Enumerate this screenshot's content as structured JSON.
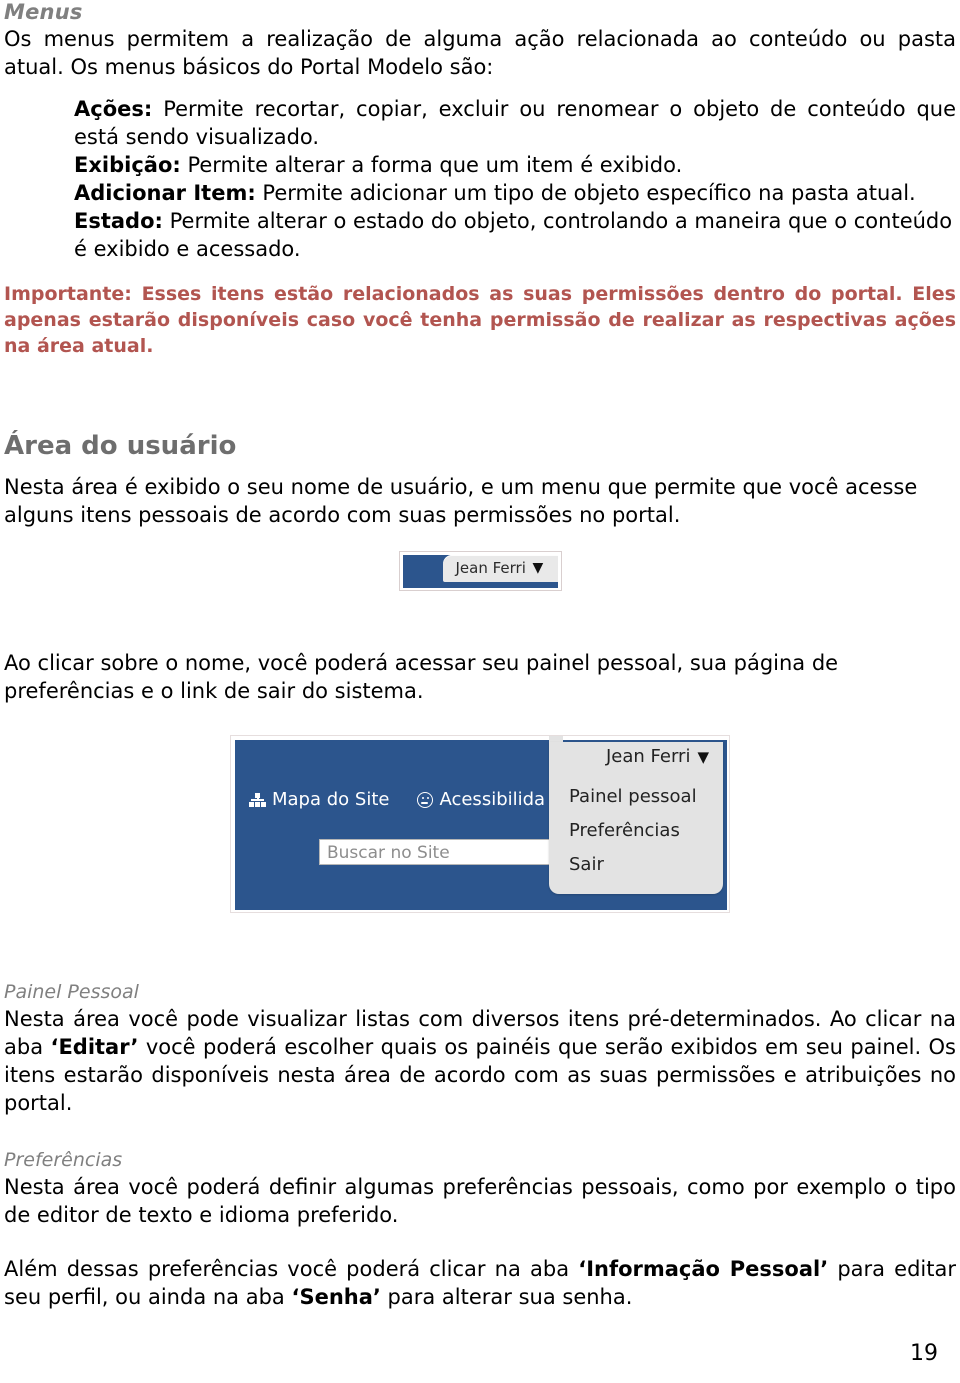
{
  "document": {
    "page_number": "19"
  },
  "sections": {
    "menus": {
      "heading": "Menus",
      "intro": "Os menus permitem a realização de alguma ação relacionada ao conteúdo ou pasta atual. Os menus básicos do Portal Modelo são:",
      "items": [
        {
          "term": "Ações:",
          "desc": "Permite recortar, copiar, excluir ou renomear o objeto de conteúdo que está sendo visualizado."
        },
        {
          "term": "Exibição:",
          "desc": "Permite alterar a forma que um item é exibido."
        },
        {
          "term": "Adicionar Item:",
          "desc": "Permite adicionar um tipo de objeto específico na pasta atual."
        },
        {
          "term": "Estado:",
          "desc": "Permite alterar o estado do objeto, controlando a maneira que o conteúdo é exibido e acessado."
        }
      ],
      "note": "Importante: Esses itens estão relacionados as suas permissões dentro do portal. Eles apenas estarão disponíveis caso você tenha permissão de realizar as respectivas ações na área atual.",
      "note_color": "#b25550"
    },
    "area_usuario": {
      "heading": "Área do usuário",
      "paragraph_1": "Nesta área é exibido o seu nome de usuário, e um menu que permite que você acesse alguns itens pessoais de acordo com suas permissões no portal.",
      "paragraph_2": "Ao clicar sobre o nome, você poderá acessar seu painel pessoal, sua página de preferências e o link de sair do sistema."
    },
    "painel_pessoal": {
      "heading": "Painel Pessoal",
      "paragraph_parts": {
        "a": "Nesta área você pode visualizar listas com diversos itens pré-determinados. Ao clicar na aba ",
        "bold_1": "‘Editar’",
        "b": " você poderá escolher quais os painéis que serão exibidos em seu painel. Os itens estarão disponíveis nesta área de acordo com as suas permissões e atribuições no portal."
      }
    },
    "preferencias": {
      "heading": "Preferências",
      "paragraph_1": "Nesta área você poderá definir algumas preferências pessoais, como por exemplo o tipo de editor de texto e idioma preferido.",
      "paragraph_2_parts": {
        "a": "Além dessas preferências você poderá clicar na aba ",
        "bold_1": "‘Informação Pessoal’",
        "b": " para editar seu perfil, ou ainda na aba ",
        "bold_2": "‘Senha’",
        "c": " para alterar sua senha."
      }
    }
  },
  "figure_user_button": {
    "user_name": "Jean Ferri",
    "caret": "▼",
    "bar_color": "#2c558d",
    "tab_color": "#e9e9e9"
  },
  "figure_header_menu": {
    "bar_color": "#2c558d",
    "sitemap_label": "Mapa do Site",
    "accessibility_label": "Acessibilida",
    "search_placeholder": "Buscar no Site",
    "user_name": "Jean Ferri",
    "caret": "▼",
    "menu_items": [
      "Painel pessoal",
      "Preferências",
      "Sair"
    ]
  }
}
